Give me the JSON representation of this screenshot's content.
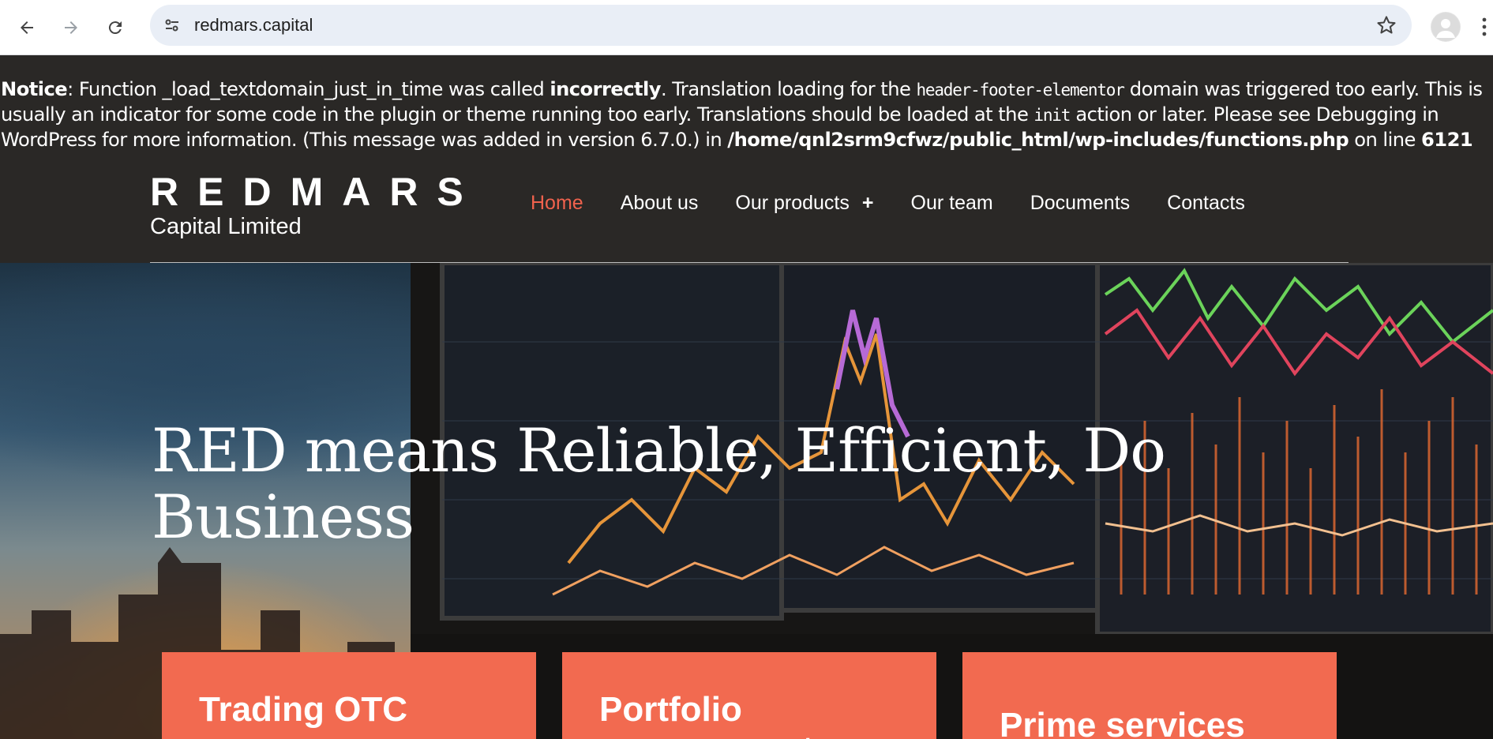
{
  "browser": {
    "url": "redmars.capital",
    "back_icon": "arrow-left-icon",
    "forward_icon": "arrow-right-icon",
    "reload_icon": "reload-icon",
    "site_info_icon": "tune-icon",
    "bookmark_icon": "star-icon",
    "profile_icon": "avatar-icon",
    "menu_icon": "more-vert-icon"
  },
  "notice": {
    "label": "Notice",
    "part1": ": Function _load_textdomain_just_in_time was called ",
    "bold1": "incorrectly",
    "part2": ". Translation loading for the ",
    "code1": "header-footer-elementor",
    "part3": " domain was triggered too early. This is usually an indicator for some code in the plugin or theme running too early. Translations should be loaded at the ",
    "code2": "init",
    "part4": " action or later. Please see Debugging in WordPress for more information. (This message was added in version 6.7.0.) in ",
    "path": "/home/qnl2srm9cfwz/public_html/wp-includes/functions.php",
    "part5": " on line ",
    "line": "6121"
  },
  "header": {
    "logo_word": "REDMARS",
    "logo_sub": "Capital Limited",
    "nav": [
      {
        "label": "Home",
        "active": true
      },
      {
        "label": "About us"
      },
      {
        "label": "Our products",
        "toggle": "+"
      },
      {
        "label": "Our team"
      },
      {
        "label": "Documents"
      },
      {
        "label": "Contacts"
      }
    ]
  },
  "hero": {
    "title": "RED means Reliable, Efficient, Do Business",
    "cards": [
      {
        "title": "Trading OTC"
      },
      {
        "title": "Portfolio management"
      },
      {
        "title": "Prime services"
      }
    ]
  },
  "colors": {
    "accent": "#f0624d",
    "card": "#f26a50",
    "header_bg": "#2a2826"
  }
}
